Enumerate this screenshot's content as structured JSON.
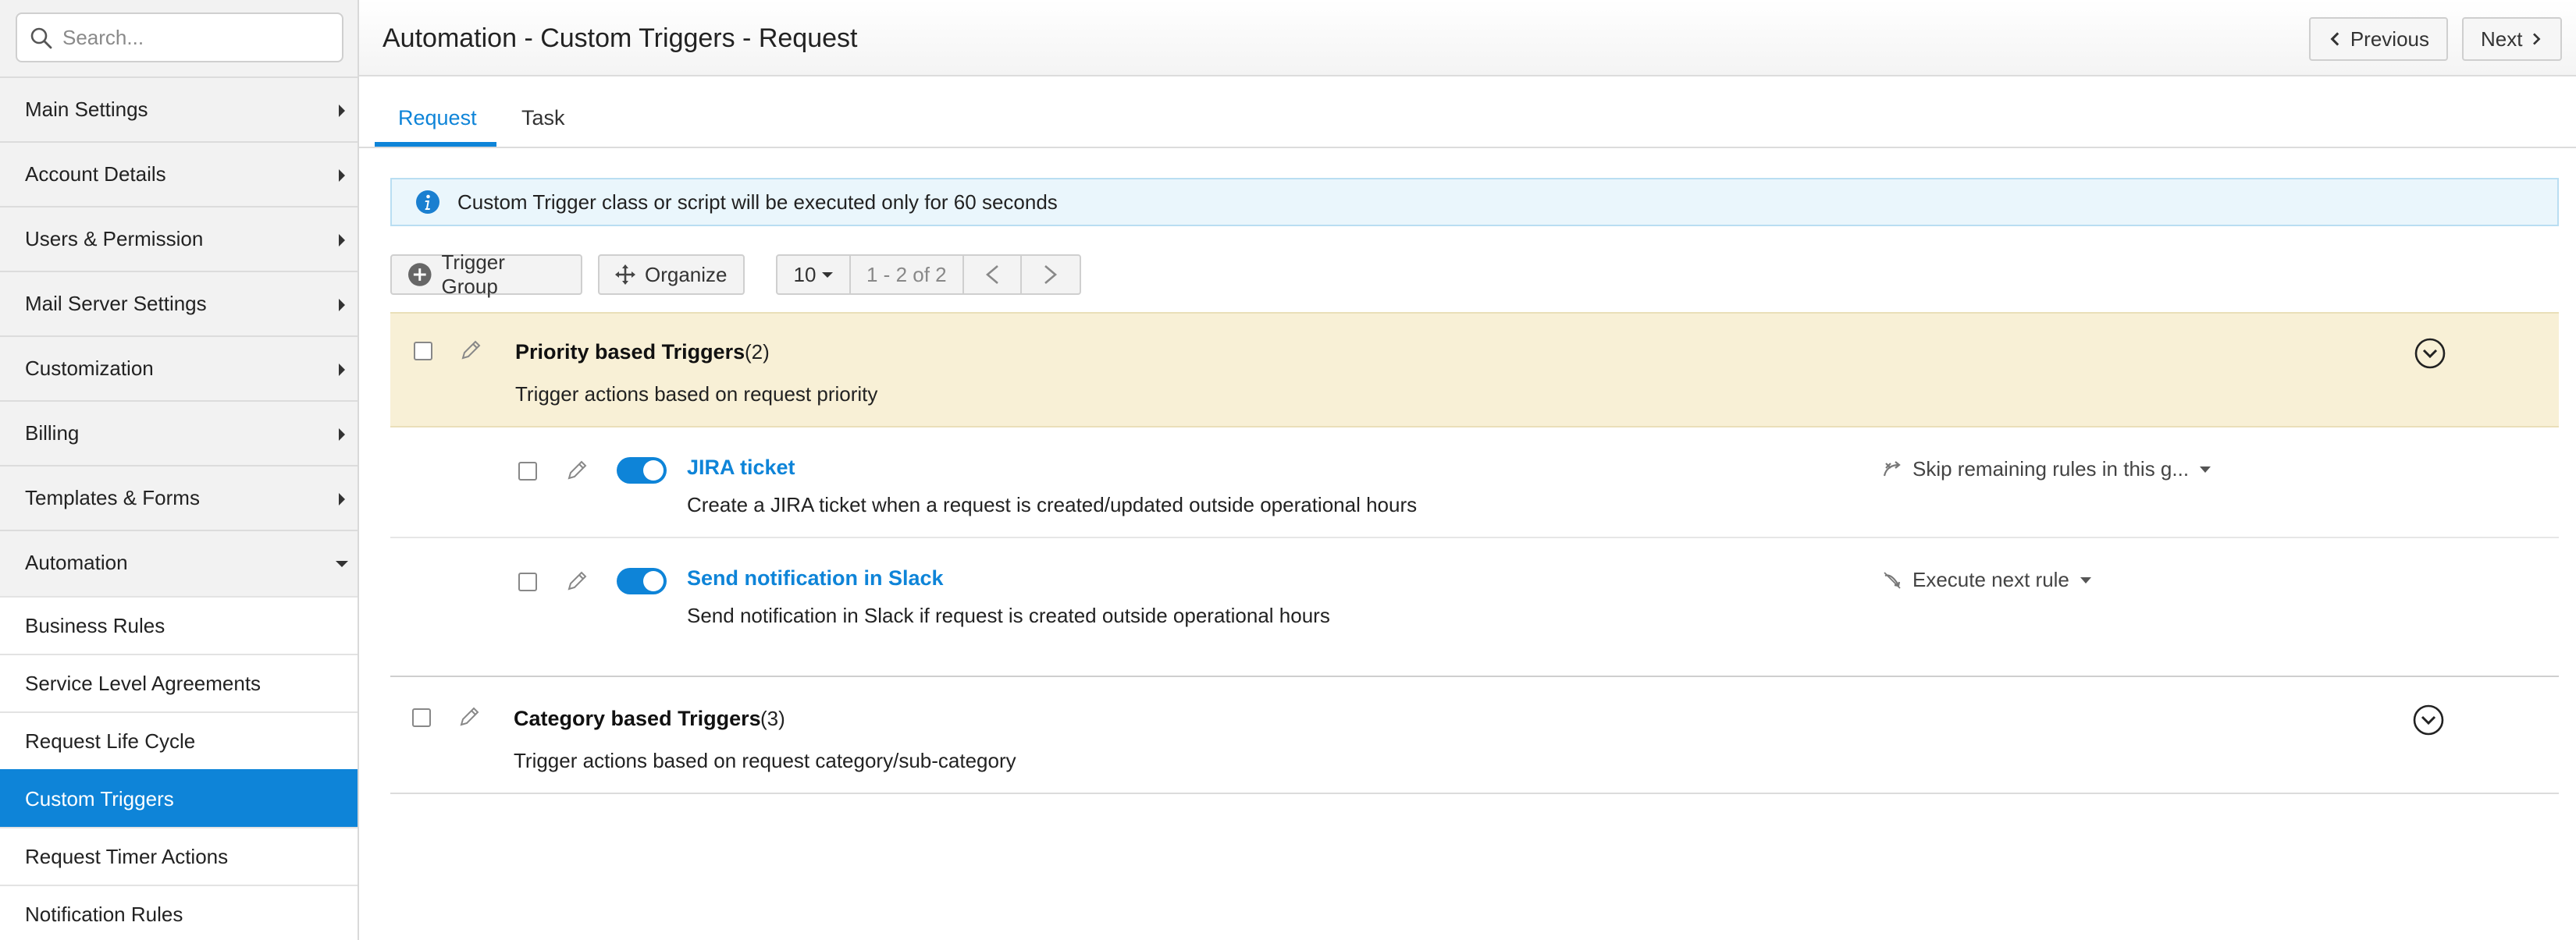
{
  "sidebar": {
    "search": {
      "placeholder": "Search..."
    },
    "menu": [
      {
        "label": "Main Settings"
      },
      {
        "label": "Account Details"
      },
      {
        "label": "Users & Permission"
      },
      {
        "label": "Mail Server Settings"
      },
      {
        "label": "Customization"
      },
      {
        "label": "Billing"
      },
      {
        "label": "Templates & Forms"
      },
      {
        "label": "Automation"
      }
    ],
    "submenu": [
      {
        "label": "Business Rules"
      },
      {
        "label": "Service Level Agreements"
      },
      {
        "label": "Request Life Cycle"
      },
      {
        "label": "Custom Triggers",
        "active": true
      },
      {
        "label": "Request Timer Actions"
      },
      {
        "label": "Notification Rules"
      }
    ]
  },
  "header": {
    "title": "Automation - Custom Triggers - Request",
    "previous_label": "Previous",
    "next_label": "Next"
  },
  "tabs": [
    {
      "label": "Request",
      "active": true
    },
    {
      "label": "Task"
    }
  ],
  "info": {
    "text": "Custom Trigger class or script will be executed only for 60 seconds"
  },
  "toolbar": {
    "trigger_group_label": "Trigger Group",
    "organize_label": "Organize",
    "page_size": "10",
    "page_range": "1 - 2 of 2"
  },
  "groups": [
    {
      "title": "Priority based Triggers",
      "count": "(2)",
      "description": "Trigger actions based on request priority",
      "rules": [
        {
          "title": "JIRA ticket",
          "description": "Create a JIRA ticket when a request is created/updated outside operational hours",
          "action": "Skip remaining rules in this g...",
          "enabled": true
        },
        {
          "title": "Send notification in Slack",
          "description": "Send notification in Slack if request is created outside operational hours",
          "action": "Execute next rule",
          "enabled": true
        }
      ]
    },
    {
      "title": "Category based Triggers",
      "count": "(3)",
      "description": "Trigger actions based on request category/sub-category"
    }
  ],
  "colors": {
    "accent": "#0e84d8",
    "group_highlight": "#f8f0d6",
    "info_background": "#eaf6fc"
  }
}
